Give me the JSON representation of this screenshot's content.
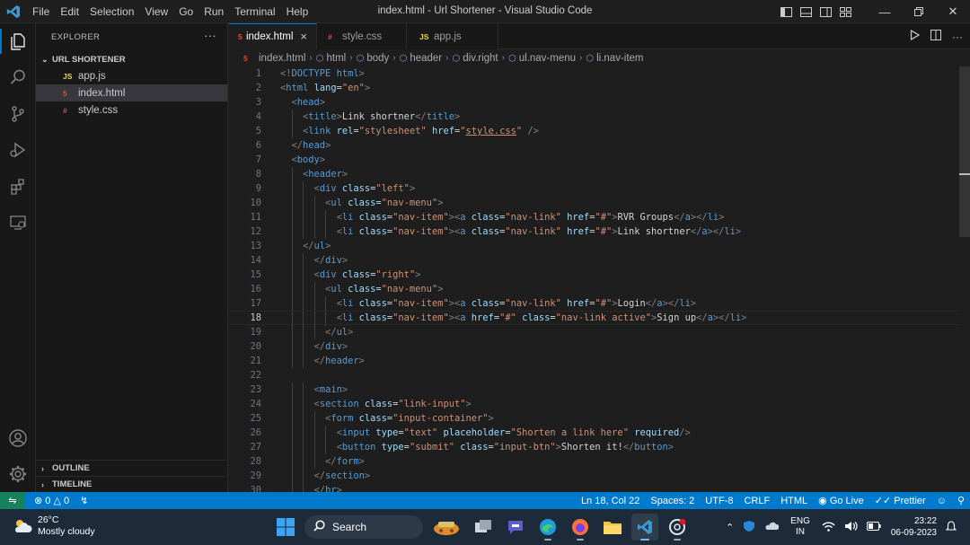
{
  "window": {
    "title": "index.html - Url Shortener - Visual Studio Code",
    "menu": [
      "File",
      "Edit",
      "Selection",
      "View",
      "Go",
      "Run",
      "Terminal",
      "Help"
    ]
  },
  "sidebar": {
    "header": "EXPLORER",
    "more": "···",
    "folder": "URL SHORTENER",
    "files": [
      {
        "icon": "JS",
        "name": "app.js"
      },
      {
        "icon": "5",
        "name": "index.html"
      },
      {
        "icon": "#",
        "name": "style.css"
      }
    ],
    "outline": "OUTLINE",
    "timeline": "TIMELINE"
  },
  "tabs": [
    {
      "icon": "5",
      "label": "index.html",
      "close": "×"
    },
    {
      "icon": "#",
      "label": "style.css"
    },
    {
      "icon": "JS",
      "label": "app.js"
    }
  ],
  "breadcrumb": [
    "index.html",
    "html",
    "body",
    "header",
    "div.right",
    "ul.nav-menu",
    "li.nav-item"
  ],
  "editor": {
    "current_line": 18,
    "lines": [
      {
        "n": 1,
        "tokens": [
          [
            "p",
            "<!"
          ],
          [
            "d",
            "DOCTYPE"
          ],
          [
            "x",
            " "
          ],
          [
            "t",
            "html"
          ],
          [
            "p",
            ">"
          ]
        ]
      },
      {
        "n": 2,
        "tokens": [
          [
            "p",
            "<"
          ],
          [
            "t",
            "html"
          ],
          [
            "x",
            " "
          ],
          [
            "a",
            "lang"
          ],
          [
            "x",
            "="
          ],
          [
            "v",
            "\"en\""
          ],
          [
            "p",
            ">"
          ]
        ]
      },
      {
        "n": 3,
        "tokens": [
          [
            "x",
            "  "
          ],
          [
            "p",
            "<"
          ],
          [
            "t",
            "head"
          ],
          [
            "p",
            ">"
          ]
        ]
      },
      {
        "n": 4,
        "tokens": [
          [
            "x",
            "    "
          ],
          [
            "p",
            "<"
          ],
          [
            "t",
            "title"
          ],
          [
            "p",
            ">"
          ],
          [
            "x",
            "Link shortner"
          ],
          [
            "p",
            "</"
          ],
          [
            "t",
            "title"
          ],
          [
            "p",
            ">"
          ]
        ]
      },
      {
        "n": 5,
        "tokens": [
          [
            "x",
            "    "
          ],
          [
            "p",
            "<"
          ],
          [
            "t",
            "link"
          ],
          [
            "x",
            " "
          ],
          [
            "a",
            "rel"
          ],
          [
            "x",
            "="
          ],
          [
            "v",
            "\"stylesheet\""
          ],
          [
            "x",
            " "
          ],
          [
            "a",
            "href"
          ],
          [
            "x",
            "="
          ],
          [
            "v",
            "\""
          ],
          [
            "u",
            "style.css"
          ],
          [
            "v",
            "\""
          ],
          [
            "x",
            " "
          ],
          [
            "p",
            "/>"
          ]
        ]
      },
      {
        "n": 6,
        "tokens": [
          [
            "x",
            "  "
          ],
          [
            "p",
            "</"
          ],
          [
            "t",
            "head"
          ],
          [
            "p",
            ">"
          ]
        ]
      },
      {
        "n": 7,
        "tokens": [
          [
            "x",
            "  "
          ],
          [
            "p",
            "<"
          ],
          [
            "t",
            "body"
          ],
          [
            "p",
            ">"
          ]
        ]
      },
      {
        "n": 8,
        "tokens": [
          [
            "x",
            "    "
          ],
          [
            "p",
            "<"
          ],
          [
            "t",
            "header"
          ],
          [
            "p",
            ">"
          ]
        ]
      },
      {
        "n": 9,
        "tokens": [
          [
            "x",
            "      "
          ],
          [
            "p",
            "<"
          ],
          [
            "t",
            "div"
          ],
          [
            "x",
            " "
          ],
          [
            "a",
            "class"
          ],
          [
            "x",
            "="
          ],
          [
            "v",
            "\"left\""
          ],
          [
            "p",
            ">"
          ]
        ]
      },
      {
        "n": 10,
        "tokens": [
          [
            "x",
            "        "
          ],
          [
            "p",
            "<"
          ],
          [
            "t",
            "ul"
          ],
          [
            "x",
            " "
          ],
          [
            "a",
            "class"
          ],
          [
            "x",
            "="
          ],
          [
            "v",
            "\"nav-menu\""
          ],
          [
            "p",
            ">"
          ]
        ]
      },
      {
        "n": 11,
        "tokens": [
          [
            "x",
            "          "
          ],
          [
            "p",
            "<"
          ],
          [
            "t",
            "li"
          ],
          [
            "x",
            " "
          ],
          [
            "a",
            "class"
          ],
          [
            "x",
            "="
          ],
          [
            "v",
            "\"nav-item\""
          ],
          [
            "p",
            ">"
          ],
          [
            "p",
            "<"
          ],
          [
            "t",
            "a"
          ],
          [
            "x",
            " "
          ],
          [
            "a",
            "class"
          ],
          [
            "x",
            "="
          ],
          [
            "v",
            "\"nav-link\""
          ],
          [
            "x",
            " "
          ],
          [
            "a",
            "href"
          ],
          [
            "x",
            "="
          ],
          [
            "v",
            "\"#\""
          ],
          [
            "p",
            ">"
          ],
          [
            "x",
            "RVR Groups"
          ],
          [
            "p",
            "</"
          ],
          [
            "t",
            "a"
          ],
          [
            "p",
            ">"
          ],
          [
            "p",
            "</"
          ],
          [
            "t",
            "li"
          ],
          [
            "p",
            ">"
          ]
        ]
      },
      {
        "n": 12,
        "tokens": [
          [
            "x",
            "          "
          ],
          [
            "p",
            "<"
          ],
          [
            "t",
            "li"
          ],
          [
            "x",
            " "
          ],
          [
            "a",
            "class"
          ],
          [
            "x",
            "="
          ],
          [
            "v",
            "\"nav-item\""
          ],
          [
            "p",
            ">"
          ],
          [
            "p",
            "<"
          ],
          [
            "t",
            "a"
          ],
          [
            "x",
            " "
          ],
          [
            "a",
            "class"
          ],
          [
            "x",
            "="
          ],
          [
            "v",
            "\"nav-link\""
          ],
          [
            "x",
            " "
          ],
          [
            "a",
            "href"
          ],
          [
            "x",
            "="
          ],
          [
            "v",
            "\"#\""
          ],
          [
            "p",
            ">"
          ],
          [
            "x",
            "Link shortner"
          ],
          [
            "p",
            "</"
          ],
          [
            "t",
            "a"
          ],
          [
            "p",
            ">"
          ],
          [
            "p",
            "</"
          ],
          [
            "t",
            "li"
          ],
          [
            "p",
            ">"
          ]
        ]
      },
      {
        "n": 13,
        "tokens": [
          [
            "x",
            "    "
          ],
          [
            "p",
            "</"
          ],
          [
            "t",
            "ul"
          ],
          [
            "p",
            ">"
          ]
        ]
      },
      {
        "n": 14,
        "tokens": [
          [
            "x",
            "      "
          ],
          [
            "p",
            "</"
          ],
          [
            "t",
            "div"
          ],
          [
            "p",
            ">"
          ]
        ]
      },
      {
        "n": 15,
        "tokens": [
          [
            "x",
            "      "
          ],
          [
            "p",
            "<"
          ],
          [
            "t",
            "div"
          ],
          [
            "x",
            " "
          ],
          [
            "a",
            "class"
          ],
          [
            "x",
            "="
          ],
          [
            "v",
            "\"right\""
          ],
          [
            "p",
            ">"
          ]
        ]
      },
      {
        "n": 16,
        "tokens": [
          [
            "x",
            "        "
          ],
          [
            "p",
            "<"
          ],
          [
            "t",
            "ul"
          ],
          [
            "x",
            " "
          ],
          [
            "a",
            "class"
          ],
          [
            "x",
            "="
          ],
          [
            "v",
            "\"nav-menu\""
          ],
          [
            "p",
            ">"
          ]
        ]
      },
      {
        "n": 17,
        "tokens": [
          [
            "x",
            "          "
          ],
          [
            "p",
            "<"
          ],
          [
            "t",
            "li"
          ],
          [
            "x",
            " "
          ],
          [
            "a",
            "class"
          ],
          [
            "x",
            "="
          ],
          [
            "v",
            "\"nav-item\""
          ],
          [
            "p",
            ">"
          ],
          [
            "p",
            "<"
          ],
          [
            "t",
            "a"
          ],
          [
            "x",
            " "
          ],
          [
            "a",
            "class"
          ],
          [
            "x",
            "="
          ],
          [
            "v",
            "\"nav-link\""
          ],
          [
            "x",
            " "
          ],
          [
            "a",
            "href"
          ],
          [
            "x",
            "="
          ],
          [
            "v",
            "\"#\""
          ],
          [
            "p",
            ">"
          ],
          [
            "x",
            "Login"
          ],
          [
            "p",
            "</"
          ],
          [
            "t",
            "a"
          ],
          [
            "p",
            ">"
          ],
          [
            "p",
            "</"
          ],
          [
            "t",
            "li"
          ],
          [
            "p",
            ">"
          ]
        ]
      },
      {
        "n": 18,
        "tokens": [
          [
            "x",
            "          "
          ],
          [
            "p",
            "<"
          ],
          [
            "t",
            "li"
          ],
          [
            "x",
            " "
          ],
          [
            "a",
            "class"
          ],
          [
            "x",
            "="
          ],
          [
            "v",
            "\"nav-item\""
          ],
          [
            "p",
            ">"
          ],
          [
            "p",
            "<"
          ],
          [
            "t",
            "a"
          ],
          [
            "x",
            " "
          ],
          [
            "a",
            "href"
          ],
          [
            "x",
            "="
          ],
          [
            "v",
            "\"#\""
          ],
          [
            "x",
            " "
          ],
          [
            "a",
            "class"
          ],
          [
            "x",
            "="
          ],
          [
            "v",
            "\"nav-link active\""
          ],
          [
            "p",
            ">"
          ],
          [
            "x",
            "Sign up"
          ],
          [
            "p",
            "</"
          ],
          [
            "t",
            "a"
          ],
          [
            "p",
            ">"
          ],
          [
            "p",
            "</"
          ],
          [
            "t",
            "li"
          ],
          [
            "p",
            ">"
          ]
        ]
      },
      {
        "n": 19,
        "tokens": [
          [
            "x",
            "        "
          ],
          [
            "p",
            "</"
          ],
          [
            "t",
            "ul"
          ],
          [
            "p",
            ">"
          ]
        ]
      },
      {
        "n": 20,
        "tokens": [
          [
            "x",
            "      "
          ],
          [
            "p",
            "</"
          ],
          [
            "t",
            "div"
          ],
          [
            "p",
            ">"
          ]
        ]
      },
      {
        "n": 21,
        "tokens": [
          [
            "x",
            "      "
          ],
          [
            "p",
            "</"
          ],
          [
            "t",
            "header"
          ],
          [
            "p",
            ">"
          ]
        ]
      },
      {
        "n": 22,
        "tokens": []
      },
      {
        "n": 23,
        "tokens": [
          [
            "x",
            "      "
          ],
          [
            "p",
            "<"
          ],
          [
            "t",
            "main"
          ],
          [
            "p",
            ">"
          ]
        ]
      },
      {
        "n": 24,
        "tokens": [
          [
            "x",
            "      "
          ],
          [
            "p",
            "<"
          ],
          [
            "t",
            "section"
          ],
          [
            "x",
            " "
          ],
          [
            "a",
            "class"
          ],
          [
            "x",
            "="
          ],
          [
            "v",
            "\"link-input\""
          ],
          [
            "p",
            ">"
          ]
        ]
      },
      {
        "n": 25,
        "tokens": [
          [
            "x",
            "        "
          ],
          [
            "p",
            "<"
          ],
          [
            "t",
            "form"
          ],
          [
            "x",
            " "
          ],
          [
            "a",
            "class"
          ],
          [
            "x",
            "="
          ],
          [
            "v",
            "\"input-container\""
          ],
          [
            "p",
            ">"
          ]
        ]
      },
      {
        "n": 26,
        "tokens": [
          [
            "x",
            "          "
          ],
          [
            "p",
            "<"
          ],
          [
            "t",
            "input"
          ],
          [
            "x",
            " "
          ],
          [
            "a",
            "type"
          ],
          [
            "x",
            "="
          ],
          [
            "v",
            "\"text\""
          ],
          [
            "x",
            " "
          ],
          [
            "a",
            "placeholder"
          ],
          [
            "x",
            "="
          ],
          [
            "v",
            "\"Shorten a link here\""
          ],
          [
            "x",
            " "
          ],
          [
            "a",
            "required"
          ],
          [
            "p",
            "/>"
          ]
        ]
      },
      {
        "n": 27,
        "tokens": [
          [
            "x",
            "          "
          ],
          [
            "p",
            "<"
          ],
          [
            "t",
            "button"
          ],
          [
            "x",
            " "
          ],
          [
            "a",
            "type"
          ],
          [
            "x",
            "="
          ],
          [
            "v",
            "\"submit\""
          ],
          [
            "x",
            " "
          ],
          [
            "a",
            "class"
          ],
          [
            "x",
            "="
          ],
          [
            "v",
            "\"input-btn\""
          ],
          [
            "p",
            ">"
          ],
          [
            "x",
            "Shorten it!"
          ],
          [
            "p",
            "</"
          ],
          [
            "t",
            "button"
          ],
          [
            "p",
            ">"
          ]
        ]
      },
      {
        "n": 28,
        "tokens": [
          [
            "x",
            "        "
          ],
          [
            "p",
            "</"
          ],
          [
            "t",
            "form"
          ],
          [
            "p",
            ">"
          ]
        ]
      },
      {
        "n": 29,
        "tokens": [
          [
            "x",
            "      "
          ],
          [
            "p",
            "</"
          ],
          [
            "t",
            "section"
          ],
          [
            "p",
            ">"
          ]
        ]
      },
      {
        "n": 30,
        "tokens": [
          [
            "x",
            "      "
          ],
          [
            "p",
            "</"
          ],
          [
            "t",
            "br"
          ],
          [
            "p",
            ">"
          ]
        ]
      }
    ]
  },
  "statusbar": {
    "errors": "0",
    "warnings": "0",
    "position": "Ln 18, Col 22",
    "spaces": "Spaces: 2",
    "encoding": "UTF-8",
    "eol": "CRLF",
    "language": "HTML",
    "golive": "Go Live",
    "prettier": "Prettier"
  },
  "taskbar": {
    "temperature": "26°C",
    "weather": "Mostly cloudy",
    "search": "Search",
    "lang_top": "ENG",
    "lang_bottom": "IN",
    "time": "23:22",
    "date": "06-09-2023"
  },
  "colors": {
    "accent": "#007acc",
    "activity_indicator": "#0078d4",
    "remote": "#16825d"
  }
}
